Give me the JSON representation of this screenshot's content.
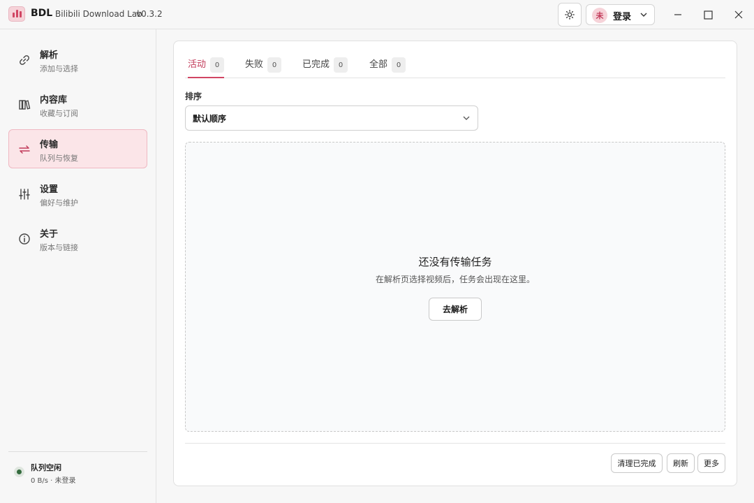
{
  "titlebar": {
    "app_name": "BDL",
    "app_subtitle": "Bilibili Download Lab",
    "version": "v0.3.2",
    "login_avatar": "未",
    "login_label": "登录",
    "icons": [
      "app-logo-icon",
      "sun-icon",
      "chevron-down-icon",
      "minimize-icon",
      "maximize-icon",
      "close-icon"
    ]
  },
  "sidebar": {
    "items": [
      {
        "title": "解析",
        "subtitle": "添加与选择",
        "icon": "link-icon",
        "active": false
      },
      {
        "title": "内容库",
        "subtitle": "收藏与订阅",
        "icon": "library-icon",
        "active": false
      },
      {
        "title": "传输",
        "subtitle": "队列与恢复",
        "icon": "transfer-icon",
        "active": true
      },
      {
        "title": "设置",
        "subtitle": "偏好与维护",
        "icon": "sliders-icon",
        "active": false
      },
      {
        "title": "关于",
        "subtitle": "版本与链接",
        "icon": "info-icon",
        "active": false
      }
    ],
    "status": {
      "title": "队列空闲",
      "subtitle": "0 B/s · 未登录"
    }
  },
  "main": {
    "tabs": [
      {
        "label": "活动",
        "count": "0",
        "active": true
      },
      {
        "label": "失败",
        "count": "0",
        "active": false
      },
      {
        "label": "已完成",
        "count": "0",
        "active": false
      },
      {
        "label": "全部",
        "count": "0",
        "active": false
      }
    ],
    "sort": {
      "label": "排序",
      "value": "默认顺序"
    },
    "empty": {
      "title": "还没有传输任务",
      "description": "在解析页选择视频后，任务会出现在这里。",
      "action": "去解析"
    },
    "footer": {
      "clear_completed": "清理已完成",
      "refresh": "刷新",
      "more": "更多"
    }
  },
  "colors": {
    "accent": "#d14563",
    "accent_bg": "#fbe5e8",
    "status_ok": "#356c3f"
  }
}
